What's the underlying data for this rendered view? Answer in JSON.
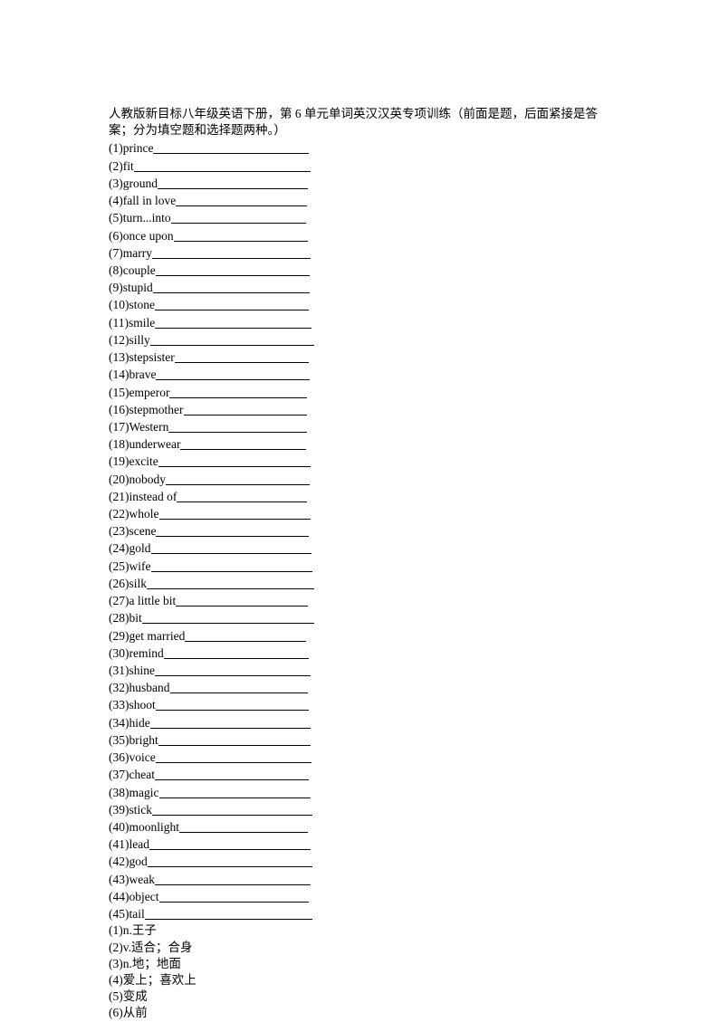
{
  "title": "人教版新目标八年级英语下册，第 6 单元单词英汉汉英专项训练（前面是题，后面紧接是答案；分为填空题和选择题两种。）",
  "questions": [
    {
      "num": "(1)",
      "word": "prince",
      "blank_width": 172
    },
    {
      "num": "(2)",
      "word": "fit",
      "blank_width": 195
    },
    {
      "num": "(3)",
      "word": "ground",
      "blank_width": 166
    },
    {
      "num": "(4)",
      "word": "fall in love",
      "blank_width": 145
    },
    {
      "num": "(5)",
      "word": "turn...into",
      "blank_width": 149
    },
    {
      "num": "(6)",
      "word": "once upon",
      "blank_width": 148
    },
    {
      "num": "(7)",
      "word": "marry",
      "blank_width": 175
    },
    {
      "num": "(8)",
      "word": "couple",
      "blank_width": 170
    },
    {
      "num": "(9)",
      "word": "stupid",
      "blank_width": 173
    },
    {
      "num": "(10)",
      "word": "stone",
      "blank_width": 170
    },
    {
      "num": "(11)",
      "word": "smile",
      "blank_width": 173
    },
    {
      "num": "(12)",
      "word": "silly",
      "blank_width": 181
    },
    {
      "num": "(13)",
      "word": "stepsister",
      "blank_width": 148
    },
    {
      "num": "(14)",
      "word": "brave",
      "blank_width": 170
    },
    {
      "num": "(15)",
      "word": "emperor",
      "blank_width": 152
    },
    {
      "num": "(16)",
      "word": "stepmother",
      "blank_width": 136
    },
    {
      "num": "(17)",
      "word": "Western",
      "blank_width": 153
    },
    {
      "num": "(18)",
      "word": "underwear",
      "blank_width": 139
    },
    {
      "num": "(19)",
      "word": "excite",
      "blank_width": 168
    },
    {
      "num": "(20)",
      "word": "nobody",
      "blank_width": 159
    },
    {
      "num": "(21)",
      "word": "instead of",
      "blank_width": 144
    },
    {
      "num": "(22)",
      "word": "whole",
      "blank_width": 167
    },
    {
      "num": "(23)",
      "word": "scene",
      "blank_width": 169
    },
    {
      "num": "(24)",
      "word": "gold",
      "blank_width": 177
    },
    {
      "num": "(25)",
      "word": "wife",
      "blank_width": 178
    },
    {
      "num": "(26)",
      "word": "silk",
      "blank_width": 185
    },
    {
      "num": "(27)",
      "word": "a little bit",
      "blank_width": 146
    },
    {
      "num": "(28)",
      "word": "bit",
      "blank_width": 190
    },
    {
      "num": "(29)",
      "word": "get married",
      "blank_width": 134
    },
    {
      "num": "(30)",
      "word": "remind",
      "blank_width": 160
    },
    {
      "num": "(31)",
      "word": "shine",
      "blank_width": 172
    },
    {
      "num": "(32)",
      "word": "husband",
      "blank_width": 152
    },
    {
      "num": "(33)",
      "word": "shoot",
      "blank_width": 169
    },
    {
      "num": "(34)",
      "word": "hide",
      "blank_width": 177
    },
    {
      "num": "(35)",
      "word": "bright",
      "blank_width": 168
    },
    {
      "num": "(36)",
      "word": "voice",
      "blank_width": 172
    },
    {
      "num": "(37)",
      "word": "cheat",
      "blank_width": 170
    },
    {
      "num": "(38)",
      "word": "magic",
      "blank_width": 167
    },
    {
      "num": "(39)",
      "word": "stick",
      "blank_width": 177
    },
    {
      "num": "(40)",
      "word": "moonlight",
      "blank_width": 142
    },
    {
      "num": "(41)",
      "word": "lead",
      "blank_width": 178
    },
    {
      "num": "(42)",
      "word": "god",
      "blank_width": 182
    },
    {
      "num": "(43)",
      "word": "weak",
      "blank_width": 172
    },
    {
      "num": "(44)",
      "word": "object",
      "blank_width": 165
    },
    {
      "num": "(45)",
      "word": "tail",
      "blank_width": 185
    }
  ],
  "answers": [
    {
      "num": "(1)",
      "text": "n.王子"
    },
    {
      "num": "(2)",
      "text": "v.适合；合身"
    },
    {
      "num": "(3)",
      "text": "n.地；地面"
    },
    {
      "num": "(4)",
      "text": "爱上；喜欢上"
    },
    {
      "num": "(5)",
      "text": "变成"
    },
    {
      "num": "(6)",
      "text": "从前"
    }
  ]
}
